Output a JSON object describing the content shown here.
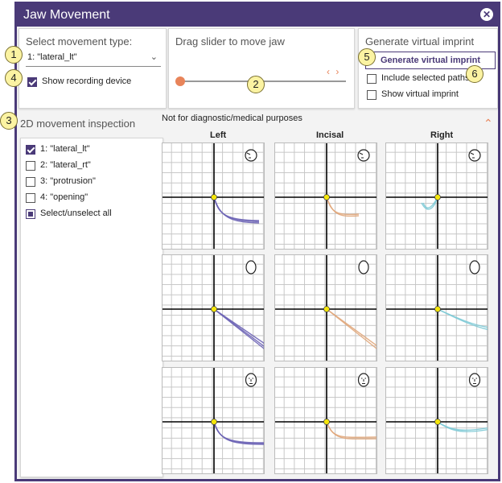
{
  "window": {
    "title": "Jaw Movement",
    "close_glyph": "✕"
  },
  "movement_panel": {
    "label": "Select movement type:",
    "selected": "1: \"lateral_lt\"",
    "show_device_label": "Show recording device",
    "show_device_checked": true
  },
  "slider_panel": {
    "label": "Drag slider to move jaw",
    "value": 0.0,
    "arrows": "‹ ›"
  },
  "imprint_panel": {
    "label": "Generate virtual imprint",
    "button_label": "Generate virtual imprint",
    "include_paths_label": "Include selected paths",
    "include_paths_checked": false,
    "show_imprint_label": "Show virtual imprint",
    "show_imprint_checked": false
  },
  "inspection": {
    "title": "2D movement inspection",
    "disclaimer": "Not for diagnostic/medical purposes",
    "collapse_glyph": "⌃",
    "columns": [
      "Left",
      "Incisal",
      "Right"
    ],
    "items": [
      {
        "label": "1: \"lateral_lt\"",
        "checked": true
      },
      {
        "label": "2: \"lateral_rt\"",
        "checked": false
      },
      {
        "label": "3: \"protrusion\"",
        "checked": false
      },
      {
        "label": "4: \"opening\"",
        "checked": false
      }
    ],
    "select_all_label": "Select/unselect all"
  },
  "callouts": [
    "1",
    "2",
    "3",
    "4",
    "5",
    "6"
  ],
  "colors": {
    "accent": "#4a3a78",
    "left_path": "#6b63b5",
    "incisal_path": "#e0a67a",
    "right_path": "#7ecad6",
    "slider": "#e8845a",
    "origin": "#f5e60a",
    "callout": "#fbf3a2"
  },
  "icons": {
    "views": [
      "side-face-icon",
      "front-face-icon",
      "face-detail-icon"
    ]
  }
}
